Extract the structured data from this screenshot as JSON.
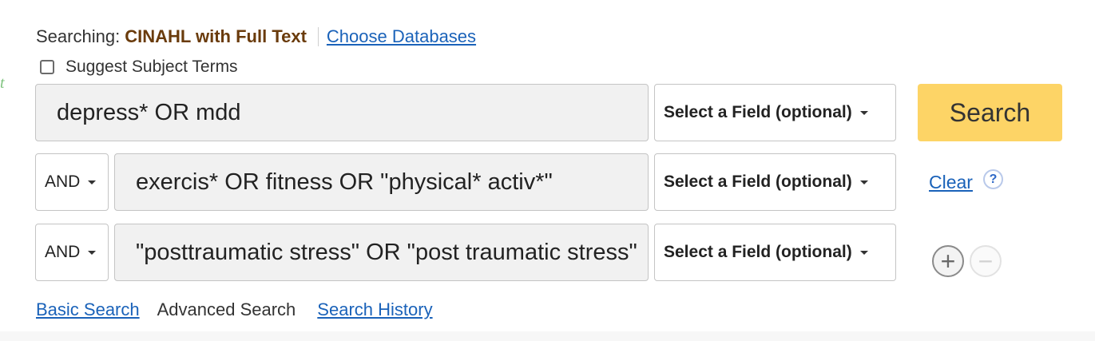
{
  "stray_glyph": "t",
  "searching": {
    "label": "Searching:",
    "database": "CINAHL with Full Text",
    "choose_link": "Choose Databases"
  },
  "suggest_terms": {
    "label": "Suggest Subject Terms",
    "checked": false
  },
  "rows": [
    {
      "query": "depress* OR mdd",
      "field": "Select a Field (optional)"
    },
    {
      "operator": "AND",
      "query": "exercis* OR fitness OR \"physical* activ*\"",
      "field": "Select a Field (optional)"
    },
    {
      "operator": "AND",
      "query": "\"posttraumatic stress\" OR \"post traumatic stress\"",
      "field": "Select a Field (optional)"
    }
  ],
  "actions": {
    "search_label": "Search",
    "clear_label": "Clear",
    "help_glyph": "?",
    "add_row_glyph": "+",
    "remove_row_glyph": "−"
  },
  "nav": {
    "basic": "Basic Search",
    "advanced": "Advanced Search",
    "history": "Search History"
  },
  "colors": {
    "accent": "#fdd466",
    "link": "#1a62b9",
    "database_name": "#6a3b0c"
  },
  "icons": {
    "help": "help-icon",
    "add": "plus-circle-icon",
    "remove": "minus-circle-icon",
    "dropdown": "caret-down-icon"
  }
}
